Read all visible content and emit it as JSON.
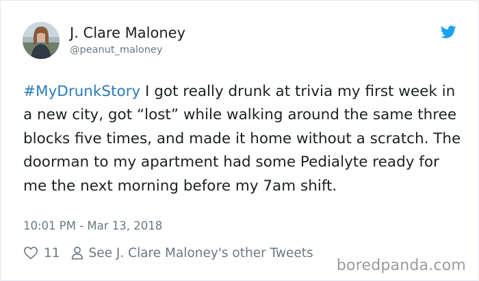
{
  "author": {
    "display_name": "J. Clare Maloney",
    "handle": "@peanut_maloney"
  },
  "tweet": {
    "hashtag": "#MyDrunkStory",
    "text": " I got really drunk at trivia my first week in a new city, got “lost” while walking around the same three blocks five times, and made it home without a scratch. The doorman to my apartment had some Pedialyte ready for me the next morning before my 7am shift.",
    "timestamp": "10:01 PM - Mar 13, 2018"
  },
  "actions": {
    "like_count": "11",
    "other_tweets_label": "See J. Clare Maloney's other Tweets"
  },
  "watermark": "boredpanda.com",
  "icons": {
    "brand": "twitter-bird-icon",
    "like": "heart-icon",
    "profile": "person-icon"
  },
  "colors": {
    "link": "#2b7bb9",
    "twitter_blue": "#1da1f2",
    "muted": "#697882",
    "text": "#1c2022"
  }
}
